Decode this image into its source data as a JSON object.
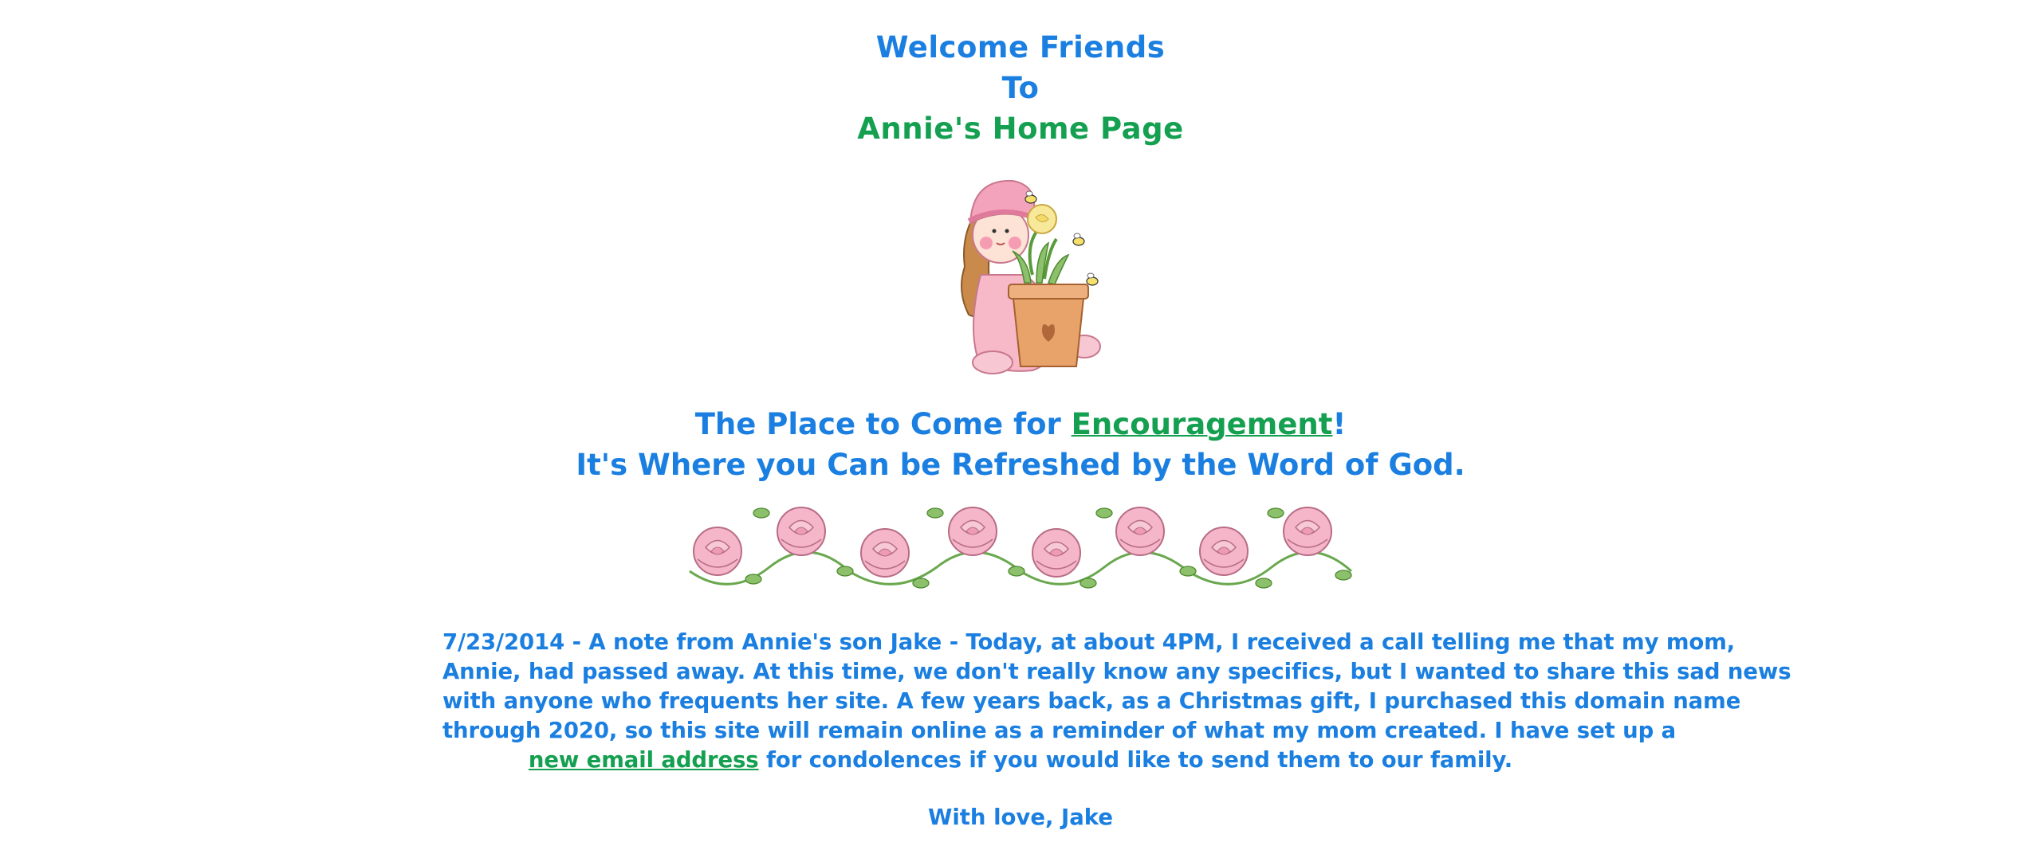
{
  "header": {
    "line1": "Welcome Friends",
    "line2": "To",
    "line3": "Annie's Home Page"
  },
  "tagline": {
    "prefix": "The Place to Come for ",
    "link": "Encouragement",
    "suffix": "!",
    "line2": "It's Where you Can be Refreshed by the Word of God."
  },
  "note": {
    "line1": "7/23/2014 - A note from Annie's son Jake - Today, at about 4PM, I received a call telling me that my mom,",
    "line2": "Annie, had passed away. At this time, we don't really know any specifics, but I wanted to share this sad news",
    "line3": "with anyone who frequents her site. A few years back, as a Christmas gift, I purchased this domain name",
    "line4": "through 2020, so this site will remain online as a reminder of what my mom created. I have set up a",
    "email_link": "new email address",
    "line5_suffix": " for condolences if you would like to send them to our family."
  },
  "signoff": "With love, Jake",
  "colors": {
    "text_blue": "#1a7fe0",
    "link_green": "#14a050",
    "rose_pink": "#f2a6c0",
    "leaf_green": "#6aa84f"
  },
  "icons": {
    "girl": "girl-with-flower-pot-image",
    "divider": "rose-divider-image"
  }
}
